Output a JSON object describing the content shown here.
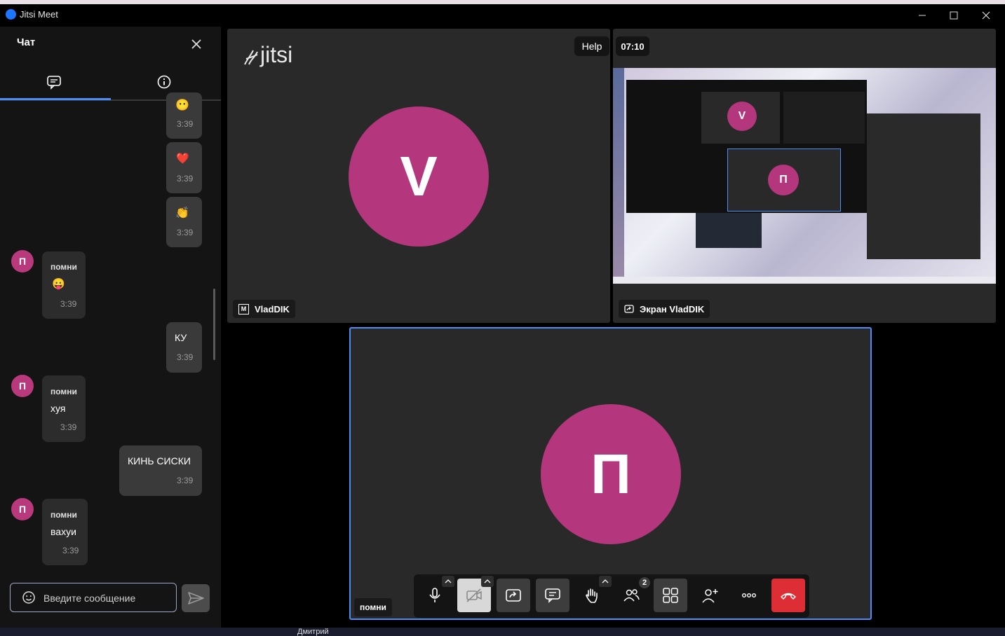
{
  "window": {
    "title": "Jitsi Meet"
  },
  "chat": {
    "title": "Чат",
    "input_placeholder": "Введите сообщение",
    "messages": [
      {
        "own": true,
        "type": "emoji",
        "emoji": "😶",
        "time": "3:39"
      },
      {
        "own": true,
        "type": "emoji",
        "emoji": "❤️",
        "time": "3:39"
      },
      {
        "own": true,
        "type": "emoji",
        "emoji": "👏",
        "time": "3:39"
      },
      {
        "own": false,
        "avatar": "П",
        "sender": "помни",
        "text": "😛",
        "time": "3:39"
      },
      {
        "own": true,
        "text": "КУ",
        "time": "3:39"
      },
      {
        "own": false,
        "avatar": "П",
        "sender": "помни",
        "text": "хуя",
        "time": "3:39"
      },
      {
        "own": true,
        "text": "КИНЬ СИСКИ",
        "time": "3:39"
      },
      {
        "own": false,
        "avatar": "П",
        "sender": "помни",
        "text": "вахуи",
        "time": "3:39"
      }
    ]
  },
  "stage": {
    "logo": "jitsi",
    "help": "Help",
    "timer": "07:10",
    "tiles": [
      {
        "avatar": "V",
        "name": "VladDIK",
        "badge": "M"
      },
      {
        "name": "Экран VladDIK",
        "mini_avatars": [
          "V",
          "П"
        ]
      },
      {
        "avatar": "П",
        "name": "помни"
      }
    ]
  },
  "toolbar": {
    "participants_count": "2"
  },
  "taskbar": {
    "item": "Дмитрий"
  },
  "colors": {
    "accent": "#4d8cf5",
    "avatar": "#b4367c",
    "hangup": "#dd2e35"
  }
}
